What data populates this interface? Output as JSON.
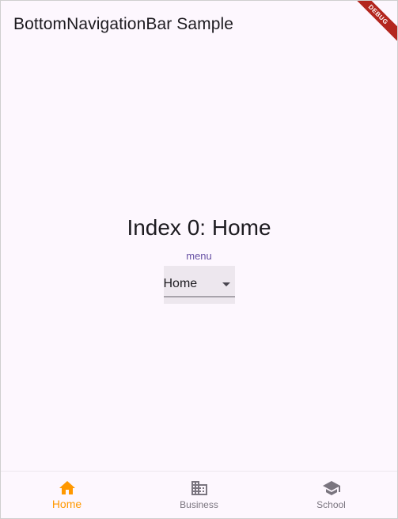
{
  "app": {
    "title": "BottomNavigationBar Sample",
    "debug_banner": "DEBUG"
  },
  "main": {
    "index_text": "Index 0: Home",
    "menu_label": "menu",
    "dropdown": {
      "selected": "Home"
    }
  },
  "bottom_nav": {
    "selected_index": 0,
    "items": [
      {
        "label": "Home",
        "icon": "home-icon"
      },
      {
        "label": "Business",
        "icon": "business-icon"
      },
      {
        "label": "School",
        "icon": "school-icon"
      }
    ]
  },
  "colors": {
    "background": "#fdf7fe",
    "active": "#ff9800",
    "inactive": "#7a757f",
    "accent": "#6750a4",
    "debug": "#b3261e"
  }
}
